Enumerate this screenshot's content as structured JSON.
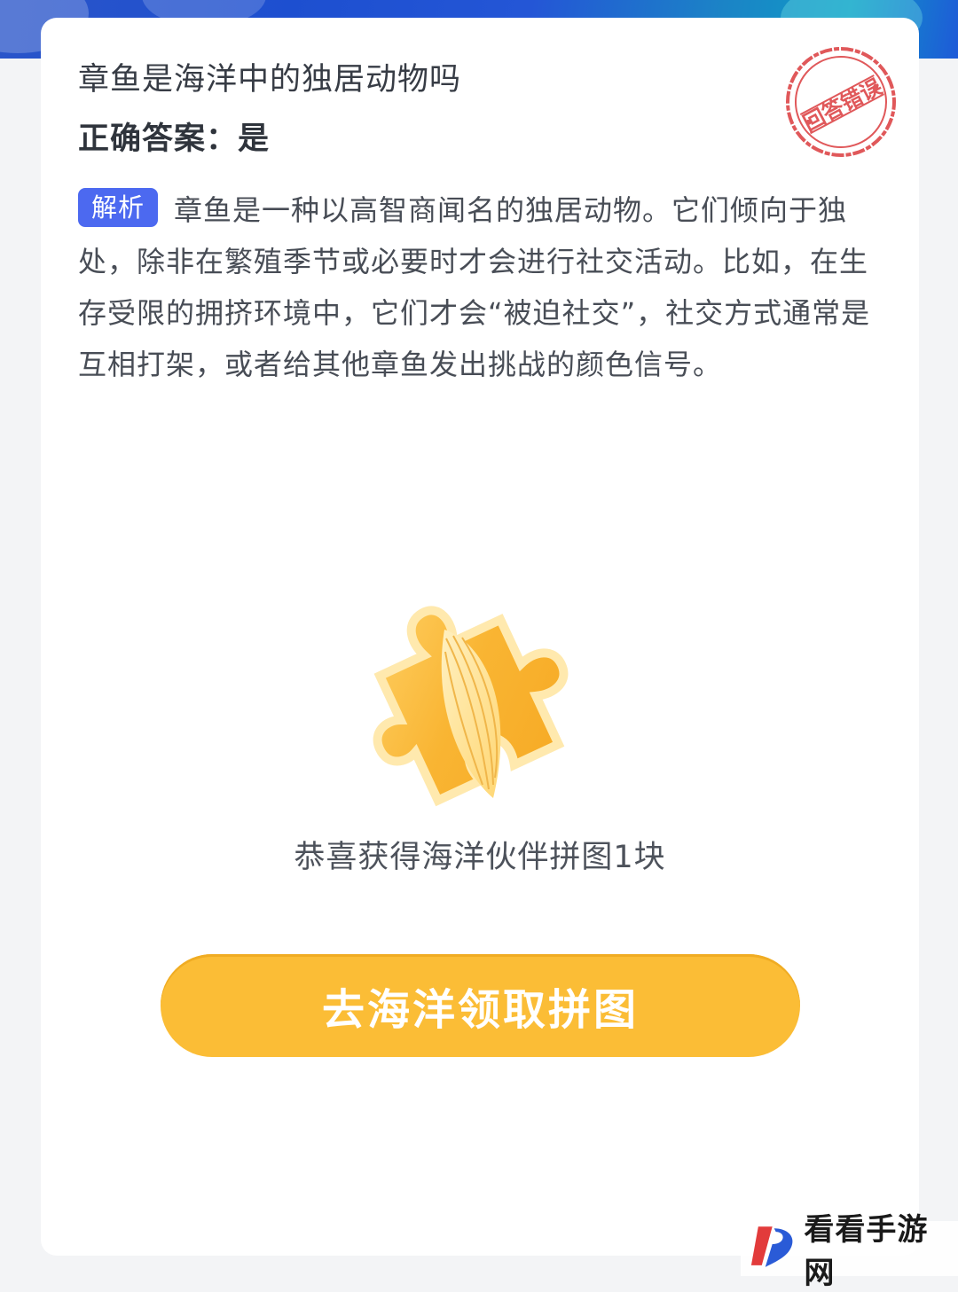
{
  "question": {
    "text": "章鱼是海洋中的独居动物吗",
    "answer_label": "正确答案：",
    "answer_value": "是"
  },
  "stamp": {
    "text": "回答错误",
    "color": "#e0585a"
  },
  "analysis": {
    "tag": "解析",
    "text": "章鱼是一种以高智商闻名的独居动物。它们倾向于独处，除非在繁殖季节或必要时才会进行社交活动。比如，在生存受限的拥挤环境中，它们才会“被迫社交”，社交方式通常是互相打架，或者给其他章鱼发出挑战的颜色信号。"
  },
  "reward": {
    "icon": "puzzle-piece-icon",
    "text": "恭喜获得海洋伙伴拼图1块"
  },
  "cta": {
    "label": "去海洋领取拼图",
    "color": "#fbbd36"
  },
  "watermark": {
    "text": "看看手游网"
  },
  "colors": {
    "accent_blue": "#4c69f0",
    "banner_blue": "#2456d6",
    "background": "#f3f4f6"
  }
}
